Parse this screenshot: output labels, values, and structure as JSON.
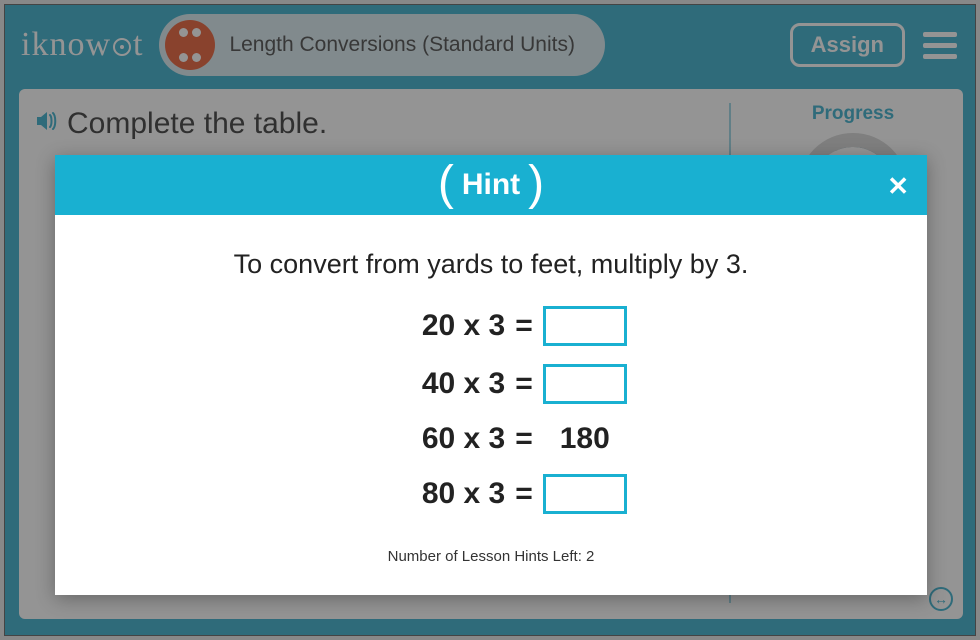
{
  "header": {
    "logo_prefix": "iknow",
    "logo_suffix": "t",
    "lesson_title": "Length Conversions (Standard Units)",
    "assign_label": "Assign"
  },
  "question": {
    "prompt": "Complete the table."
  },
  "progress": {
    "label": "Progress"
  },
  "hint": {
    "title": "Hint",
    "text": "To convert from yards to feet, multiply by 3.",
    "equations": [
      {
        "left": "20 x 3",
        "answer": "",
        "filled": false
      },
      {
        "left": "40 x 3",
        "answer": "",
        "filled": false
      },
      {
        "left": "60 x 3",
        "answer": "180",
        "filled": true
      },
      {
        "left": "80 x 3",
        "answer": "",
        "filled": false
      }
    ],
    "hints_left_label": "Number of Lesson Hints Left: 2"
  }
}
